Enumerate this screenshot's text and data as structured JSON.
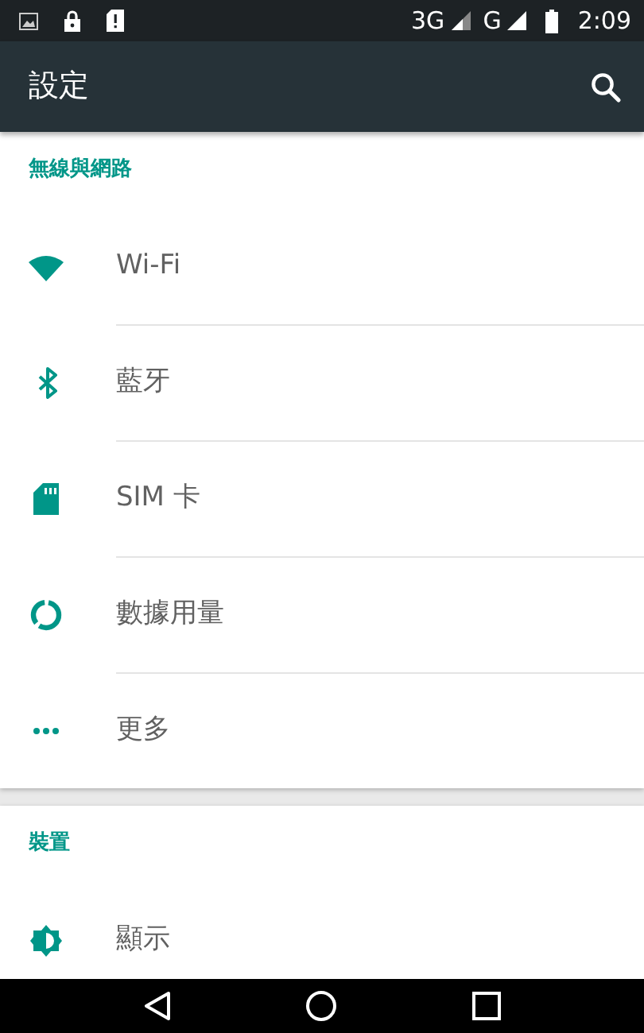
{
  "status_bar": {
    "network_1": "3G",
    "network_2": "G",
    "time": "2:09"
  },
  "app_bar": {
    "title": "設定"
  },
  "sections": [
    {
      "title": "無線與網路",
      "items": [
        {
          "label": "Wi-Fi"
        },
        {
          "label": "藍牙"
        },
        {
          "label": "SIM 卡"
        },
        {
          "label": "數據用量"
        },
        {
          "label": "更多"
        }
      ]
    },
    {
      "title": "裝置",
      "items": [
        {
          "label": "顯示"
        }
      ]
    }
  ]
}
